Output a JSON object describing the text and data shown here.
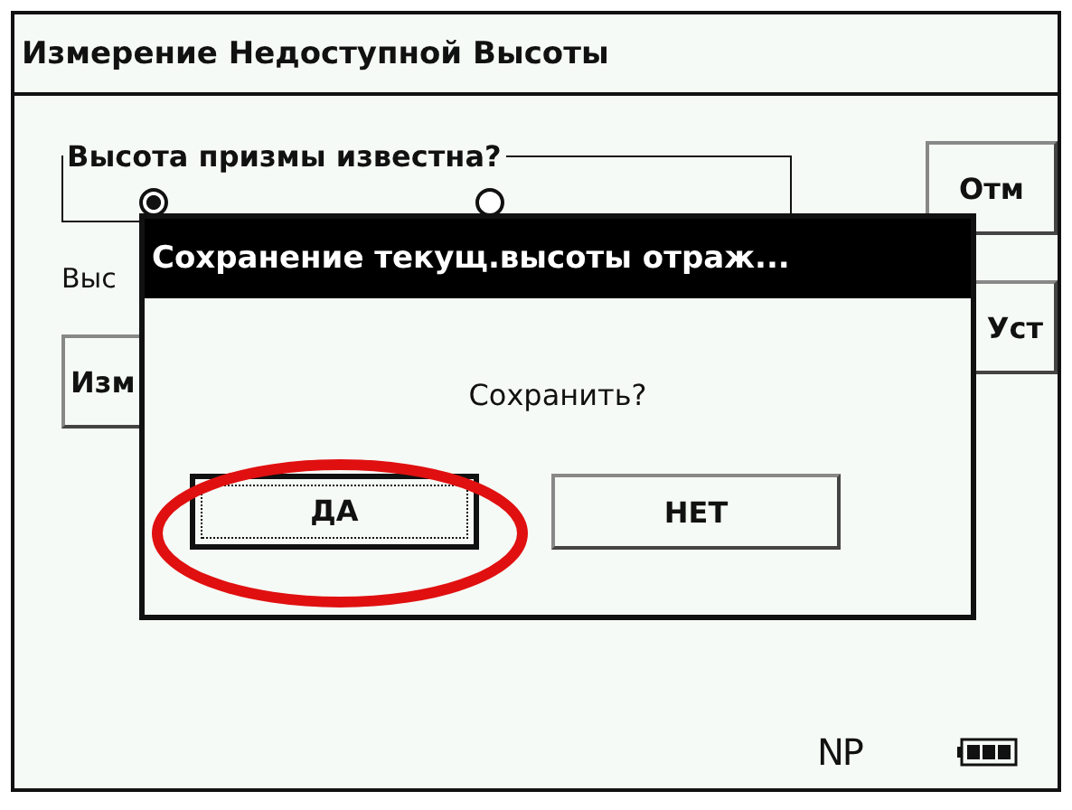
{
  "window": {
    "title": "Измерение Недоступной Высоты"
  },
  "prism_group": {
    "label": "Высота призмы известна?",
    "options": [
      {
        "selected": true
      },
      {
        "selected": false
      }
    ]
  },
  "height_label": "Выс",
  "measure_button": "Изм",
  "side_buttons": [
    "Отм",
    "Уст"
  ],
  "dialog": {
    "title": "Сохранение текущ.высоты отраж...",
    "message": "Сохранить?",
    "buttons": [
      {
        "label": "ДА",
        "focused": true,
        "highlighted": true
      },
      {
        "label": "НЕТ",
        "focused": false,
        "highlighted": false
      }
    ]
  },
  "status_bar": {
    "mode": "NP"
  }
}
